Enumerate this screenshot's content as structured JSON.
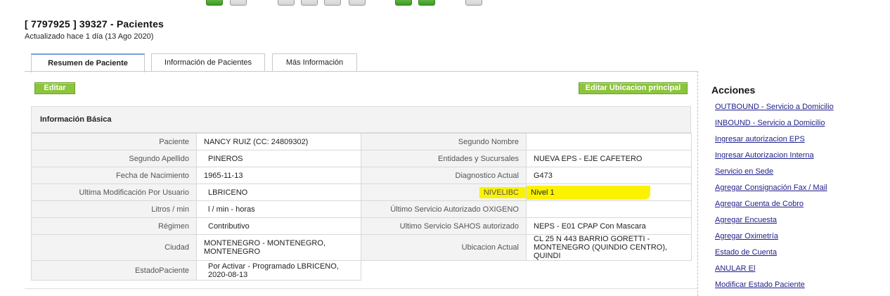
{
  "header": {
    "title": "[ 7797925 ] 39327 - Pacientes",
    "updated": "Actualizado hace 1 día (13 Ago 2020)"
  },
  "tabs": [
    {
      "label": "Resumen de Paciente",
      "active": true
    },
    {
      "label": "Información de Pacientes",
      "active": false
    },
    {
      "label": "Más Información",
      "active": false
    }
  ],
  "buttons": {
    "edit": "Editar",
    "edit_location": "Editar Ubicacion principal"
  },
  "section": {
    "title": "Información Básica"
  },
  "rows": [
    {
      "label": "Paciente",
      "value": "NANCY RUIZ (CC: 24809302)",
      "label2": "Segundo Nombre",
      "value2": ""
    },
    {
      "label": "Segundo Apellido",
      "value": "PINEROS",
      "label2": "Entidades y Sucursales",
      "value2": "NUEVA EPS - EJE CAFETERO"
    },
    {
      "label": "Fecha de Nacimiento",
      "value": "1965-11-13",
      "label2": "Diagnostico Actual",
      "value2": "G473"
    },
    {
      "label": "Ultima Modificación Por Usuario",
      "value": "LBRICENO",
      "label2": "NIVELIBC",
      "value2": "Nivel 1"
    },
    {
      "label": "Litros / min",
      "value": "l / min - horas",
      "label2": "Último Servicio Autorizado OXIGENO",
      "value2": ""
    },
    {
      "label": "Régimen",
      "value": "Contributivo",
      "label2": "Ultimo Servicio SAHOS autorizado",
      "value2": "NEPS - E01 CPAP Con Mascara"
    },
    {
      "label": "Ciudad",
      "value": "MONTENEGRO - MONTENEGRO, MONTENEGRO",
      "label2": "Ubicacion Actual",
      "value2": "CL 25 N 443 BARRIO GORETTI - MONTENEGRO (QUINDIO CENTRO), QUINDI"
    },
    {
      "label": "EstadoPaciente",
      "value": "Por Activar - Programado LBRICENO, 2020-08-13"
    }
  ],
  "highlight_color": "#fbf200",
  "accent_green": "#8cc43c",
  "acciones": {
    "title": "Acciones",
    "links": [
      "OUTBOUND - Servicio a Domicilio",
      "INBOUND - Servicio a Domicilio",
      "Ingresar autorizacion EPS",
      "Ingresar Autorizacion Interna",
      "Servicio en Sede",
      "Agregar Consignación Fax / Mail",
      "Agregar Cuenta de Cobro",
      "Agregar Encuesta",
      "Agregar Oximetría",
      "Estado de Cuenta",
      "ANULAR El",
      "Modificar Estado Paciente"
    ]
  }
}
